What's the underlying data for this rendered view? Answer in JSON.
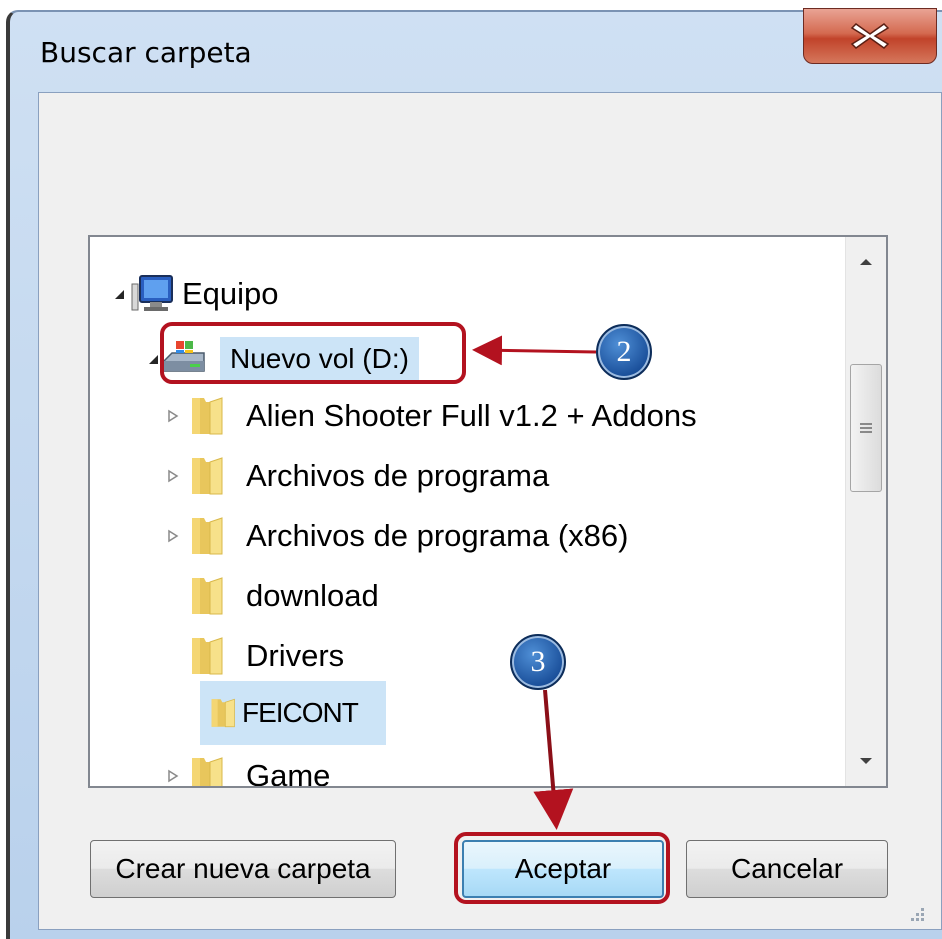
{
  "dialog": {
    "title": "Buscar carpeta"
  },
  "tree": {
    "items": [
      {
        "label": "Equipo",
        "icon": "computer-icon",
        "expanded": true
      },
      {
        "label": "Nuevo vol (D:)",
        "icon": "drive-icon",
        "expanded": true
      },
      {
        "label": "Alien Shooter Full v1.2 + Addons",
        "icon": "folder-icon",
        "has_children": true
      },
      {
        "label": "Archivos de programa",
        "icon": "folder-icon",
        "has_children": true
      },
      {
        "label": "Archivos de programa (x86)",
        "icon": "folder-icon",
        "has_children": true
      },
      {
        "label": "download",
        "icon": "folder-icon",
        "has_children": false
      },
      {
        "label": "Drivers",
        "icon": "folder-icon",
        "has_children": false
      },
      {
        "label": "FEICONT",
        "icon": "folder-icon",
        "has_children": false,
        "selected": true
      },
      {
        "label": "Game",
        "icon": "folder-icon",
        "has_children": true
      }
    ]
  },
  "buttons": {
    "new_folder": "Crear nueva carpeta",
    "ok": "Aceptar",
    "cancel": "Cancelar"
  },
  "annotations": {
    "step2": "2",
    "step3": "3",
    "color": "#b3121f"
  }
}
